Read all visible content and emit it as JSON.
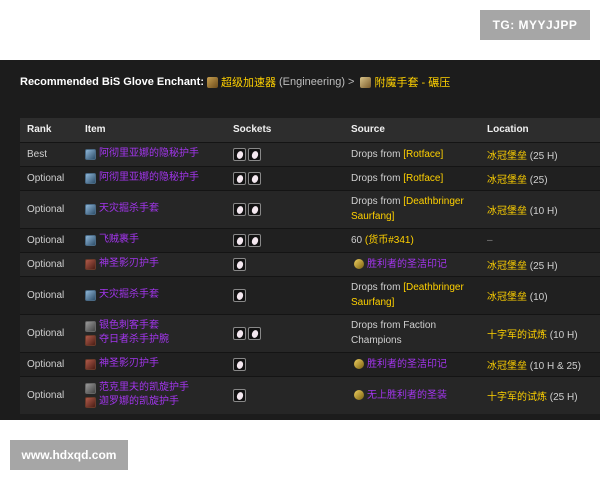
{
  "watermarks": {
    "top": "TG: MYYJJPP",
    "bottom": "www.hdxqd.com"
  },
  "recommendation": {
    "label": "Recommended BiS Glove Enchant:",
    "item": "超级加速器",
    "profession": "(Engineering)",
    "sep": ">",
    "enchant": "附魔手套 - 碾压"
  },
  "table": {
    "headers": {
      "rank": "Rank",
      "item": "Item",
      "sockets": "Sockets",
      "source": "Source",
      "location": "Location"
    },
    "rows": [
      {
        "rank": "Best",
        "items": [
          {
            "name": "阿彻里亚娜的隐秘护手",
            "icon": "glove-icon"
          }
        ],
        "sockets": 2,
        "src_pre": "Drops from ",
        "src_boss": "[Rotface]",
        "src_post": "",
        "location": "冰冠堡垒",
        "location_suffix": " (25 H)",
        "h": 23
      },
      {
        "rank": "Optional",
        "items": [
          {
            "name": "阿彻里亚娜的隐秘护手",
            "icon": "glove-icon"
          }
        ],
        "sockets": 2,
        "src_pre": "Drops from ",
        "src_boss": "[Rotface]",
        "src_post": "",
        "location": "冰冠堡垒",
        "location_suffix": " (25)",
        "h": 23
      },
      {
        "rank": "Optional",
        "items": [
          {
            "name": "天灾掘杀手套",
            "icon": "glove-icon"
          }
        ],
        "sockets": 2,
        "src_pre": "Drops from ",
        "src_boss": "[Deathbringer Saurfang]",
        "src_post": "",
        "location": "冰冠堡垒",
        "location_suffix": " (10 H)",
        "h": 36
      },
      {
        "rank": "Optional",
        "items": [
          {
            "name": "飞贼裹手",
            "icon": "glove-icon"
          }
        ],
        "sockets": 2,
        "src_pre": "60 ",
        "src_boss": "",
        "src_cur": "(货币#341)",
        "location": "",
        "location_dash": "–",
        "h": 23
      },
      {
        "rank": "Optional",
        "items": [
          {
            "name": "神圣影刃护手",
            "icon": "glove2-icon"
          }
        ],
        "sockets": 1,
        "src_badge": "胜利者的圣洁印记",
        "location": "冰冠堡垒",
        "location_suffix": " (25 H)",
        "h": 23
      },
      {
        "rank": "Optional",
        "items": [
          {
            "name": "天灾掘杀手套",
            "icon": "glove-icon"
          }
        ],
        "sockets": 1,
        "src_pre": "Drops from ",
        "src_boss": "[Deathbringer Saurfang]",
        "src_post": "",
        "location": "冰冠堡垒",
        "location_suffix": " (10)",
        "h": 36
      },
      {
        "rank": "Optional",
        "items": [
          {
            "name": "银色刺客手套",
            "icon": "glove3-icon"
          },
          {
            "name": "夺日者杀手护腕",
            "icon": "glove2-icon"
          }
        ],
        "sockets": 2,
        "src_pre": "Drops from Faction Champions",
        "src_boss": "",
        "src_post": "",
        "location": "十字军的试炼",
        "location_suffix": " (10 H)",
        "h": 36
      },
      {
        "rank": "Optional",
        "items": [
          {
            "name": "神圣影刃护手",
            "icon": "glove2-icon"
          }
        ],
        "sockets": 1,
        "src_badge": "胜利者的圣洁印记",
        "location": "冰冠堡垒",
        "location_suffix": " (10 H & 25)",
        "h": 23
      },
      {
        "rank": "Optional",
        "items": [
          {
            "name": "范克里夫的凯旋护手",
            "icon": "glove3-icon"
          },
          {
            "name": "迦罗娜的凯旋护手",
            "icon": "glove2-icon"
          }
        ],
        "sockets": 1,
        "src_badge": "无上胜利者的圣装",
        "location": "十字军的试炼",
        "location_suffix": " (25 H)",
        "h": 36
      }
    ]
  }
}
